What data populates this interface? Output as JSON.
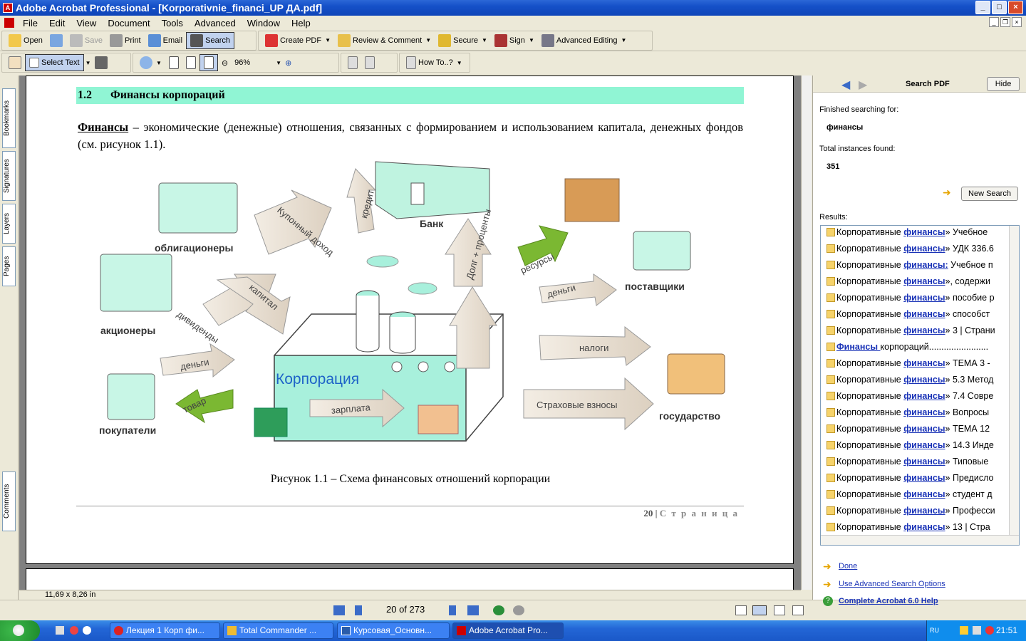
{
  "window": {
    "title": "Adobe Acrobat Professional - [Korporativnie_financi_UP ДА.pdf]"
  },
  "menu": [
    "File",
    "Edit",
    "View",
    "Document",
    "Tools",
    "Advanced",
    "Window",
    "Help"
  ],
  "toolbar1": {
    "open": "Open",
    "save": "Save",
    "print": "Print",
    "email": "Email",
    "search": "Search",
    "create_pdf": "Create PDF",
    "review": "Review & Comment",
    "secure": "Secure",
    "sign": "Sign",
    "advanced_editing": "Advanced Editing"
  },
  "toolbar2": {
    "select_text": "Select Text",
    "zoom": "96%",
    "howto": "How To..?"
  },
  "lefttabs": {
    "bookmarks": "Bookmarks",
    "signatures": "Signatures",
    "layers": "Layers",
    "pages": "Pages",
    "comments": "Comments"
  },
  "doc": {
    "heading_num": "1.2",
    "heading_text": "Финансы корпораций",
    "para_term": "Финансы",
    "para_rest": " – экономические (денежные) отношения, связанных с формированием и использованием капитала, денежных фондов (см. рисунок 1.1).",
    "figure": {
      "bank": "Банк",
      "bondholders": "облигационеры",
      "shareholders": "акционеры",
      "buyers": "покупатели",
      "suppliers": "поставщики",
      "state": "государство",
      "corporation": "Корпорация",
      "coupon": "Купонный доход",
      "credit": "кредит",
      "debt": "Долг + проценты",
      "resources": "ресурсы",
      "money1": "деньги",
      "capital": "капитал",
      "dividends": "дивиденды",
      "money2": "деньги",
      "goods": "товар",
      "taxes": "налоги",
      "insurance": "Страховые взносы",
      "salary": "зарплата"
    },
    "caption": "Рисунок 1.1 – Схема финансовых отношений корпорации",
    "page_num": "20",
    "page_label": "С т р а н и ц а"
  },
  "status": {
    "dims": "11,69 x 8,26 in"
  },
  "nav": {
    "page": "20 of 273"
  },
  "search": {
    "title": "Search PDF",
    "hide": "Hide",
    "finished_label": "Finished searching for:",
    "term": "финансы",
    "total_label": "Total instances found:",
    "total": "351",
    "new_search": "New Search",
    "results_label": "Results:",
    "results": [
      {
        "pre": "Корпоративные ",
        "hit": "финансы",
        "post": "» Учебное"
      },
      {
        "pre": "Корпоративные ",
        "hit": "финансы",
        "post": "» УДК 336.6"
      },
      {
        "pre": "Корпоративные ",
        "hit": "финансы:",
        "post": " Учебное п"
      },
      {
        "pre": "Корпоративные ",
        "hit": "финансы",
        "post": "», содержи"
      },
      {
        "pre": "Корпоративные ",
        "hit": "финансы",
        "post": "» пособие р"
      },
      {
        "pre": "Корпоративные ",
        "hit": "финансы",
        "post": "» способст"
      },
      {
        "pre": "Корпоративные ",
        "hit": "финансы",
        "post": "» 3 | Страни"
      },
      {
        "pre": "",
        "hit": "Финансы ",
        "post": "корпораций........................"
      },
      {
        "pre": "Корпоративные ",
        "hit": "финансы",
        "post": "» ТЕМА 3 -"
      },
      {
        "pre": "Корпоративные ",
        "hit": "финансы",
        "post": "» 5.3 Метод"
      },
      {
        "pre": "Корпоративные ",
        "hit": "финансы",
        "post": "» 7.4 Совре"
      },
      {
        "pre": "Корпоративные ",
        "hit": "финансы",
        "post": "» Вопросы"
      },
      {
        "pre": "Корпоративные ",
        "hit": "финансы",
        "post": "» ТЕМА 12"
      },
      {
        "pre": "Корпоративные ",
        "hit": "финансы",
        "post": "» 14.3 Инде"
      },
      {
        "pre": "Корпоративные ",
        "hit": "финансы",
        "post": "» Типовые"
      },
      {
        "pre": "Корпоративные ",
        "hit": "финансы",
        "post": "» Предисло"
      },
      {
        "pre": "Корпоративные ",
        "hit": "финансы",
        "post": "» студент д"
      },
      {
        "pre": "Корпоративные ",
        "hit": "финансы",
        "post": "» Професси"
      },
      {
        "pre": "Корпоративные ",
        "hit": "финансы",
        "post": "» 13 | Стра"
      }
    ],
    "done": "Done",
    "advanced": "Use Advanced Search Options",
    "help": "Complete Acrobat 6.0 Help"
  },
  "taskbar": {
    "tasks": [
      "Лекция 1 Корп фи...",
      "Total Commander ...",
      "Курсовая_Основн...",
      "Adobe Acrobat Pro..."
    ],
    "lang": "RU",
    "clock": "21:51"
  }
}
